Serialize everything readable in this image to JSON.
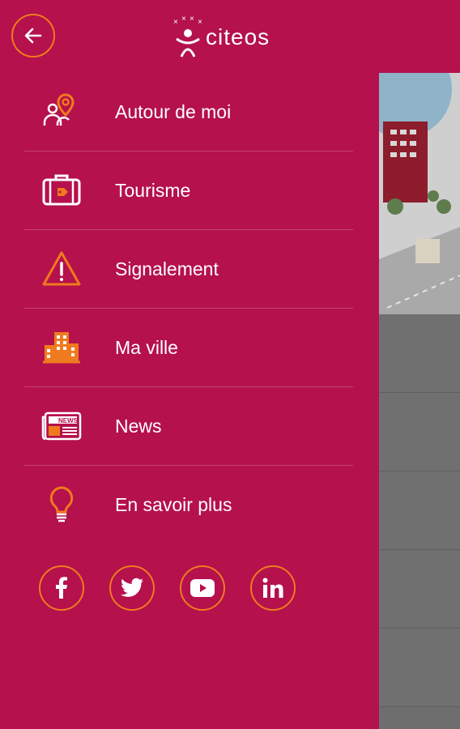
{
  "app": {
    "logo_text": "citeos",
    "accent_color": "#b5114c",
    "icon_accent_color": "#f07a1e"
  },
  "topbar": {
    "back_icon": "arrow-left-icon"
  },
  "menu": {
    "items": [
      {
        "label": "Autour de moi",
        "icon": "people-location-icon"
      },
      {
        "label": "Tourisme",
        "icon": "suitcase-icon"
      },
      {
        "label": "Signalement",
        "icon": "warning-icon"
      },
      {
        "label": "Ma ville",
        "icon": "buildings-icon"
      },
      {
        "label": "News",
        "icon": "newspaper-icon"
      },
      {
        "label": "En savoir plus",
        "icon": "lightbulb-icon"
      }
    ]
  },
  "social": {
    "items": [
      {
        "icon": "facebook-icon"
      },
      {
        "icon": "twitter-icon"
      },
      {
        "icon": "youtube-icon"
      },
      {
        "icon": "linkedin-icon"
      }
    ]
  }
}
